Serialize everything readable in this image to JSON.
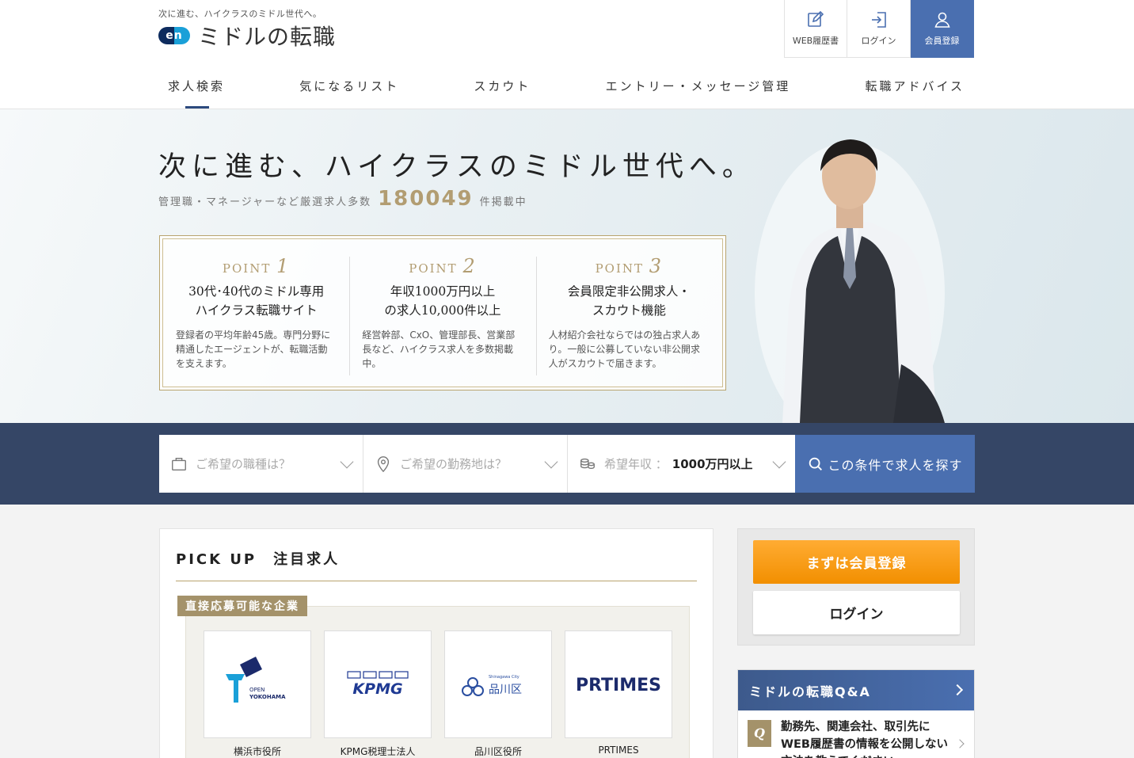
{
  "header": {
    "tagline": "次に進む、ハイクラスのミドル世代へ。",
    "logo_badge": "en",
    "logo_text": "ミドルの転職",
    "buttons": [
      {
        "label": "WEB履歴書",
        "icon": "edit-icon"
      },
      {
        "label": "ログイン",
        "icon": "login-icon"
      },
      {
        "label": "会員登録",
        "icon": "user-icon"
      }
    ]
  },
  "nav": {
    "items": [
      "求人検索",
      "気になるリスト",
      "スカウト",
      "エントリー・メッセージ管理",
      "転職アドバイス"
    ],
    "active": "求人検索"
  },
  "hero": {
    "title": "次に進む、ハイクラスのミドル世代へ。",
    "sub_prefix": "管理職・マネージャーなど厳選求人多数",
    "count": "180049",
    "sub_suffix": "件掲載中",
    "points": [
      {
        "label": "POINT",
        "num": "1",
        "title_l1": "30代･40代のミドル専用",
        "title_l2": "ハイクラス転職サイト",
        "desc": "登録者の平均年齢45歳。専門分野に精通したエージェントが、転職活動を支えます。"
      },
      {
        "label": "POINT",
        "num": "2",
        "title_l1": "年収1000万円以上",
        "title_l2": "の求人10,000件以上",
        "desc": "経営幹部、CxO、管理部長、営業部長など、ハイクラス求人を多数掲載中。"
      },
      {
        "label": "POINT",
        "num": "3",
        "title_l1": "会員限定非公開求人・",
        "title_l2": "スカウト機能",
        "desc": "人材紹介会社ならではの独占求人あり。一般に公募していない非公開求人がスカウトで届きます。"
      }
    ]
  },
  "search": {
    "job_placeholder": "ご希望の職種は？",
    "location_placeholder": "ご希望の勤務地は？",
    "salary_label": "希望年収 ：",
    "salary_value": "1000万円以上",
    "button": "この条件で求人を探す"
  },
  "pickup": {
    "title": "PICK UP　注目求人",
    "direct_label": "直接応募可能な企業",
    "companies": [
      {
        "name": "横浜市役所",
        "logo_text_1": "OPEN",
        "logo_text_2": "YOKOHAMA"
      },
      {
        "name": "KPMG税理士法人",
        "logo_text_1": "KPMG"
      },
      {
        "name": "品川区役所",
        "logo_text_1": "Shinagawa City",
        "logo_text_2": "品川区"
      },
      {
        "name": "PRTIMES",
        "logo_text_1": "PRTIMES"
      }
    ]
  },
  "sidebar": {
    "register": "まずは会員登録",
    "login": "ログイン"
  },
  "qa": {
    "title": "ミドルの転職Q&A",
    "q_mark": "Q",
    "question": "勤務先、関連会社、取引先にWEB履歴書の情報を公開しない方法を教えてください。"
  },
  "colors": {
    "navy": "#354666",
    "accent_blue": "#4a6fb0",
    "gold": "#b29d72",
    "orange": "#f28f00"
  }
}
